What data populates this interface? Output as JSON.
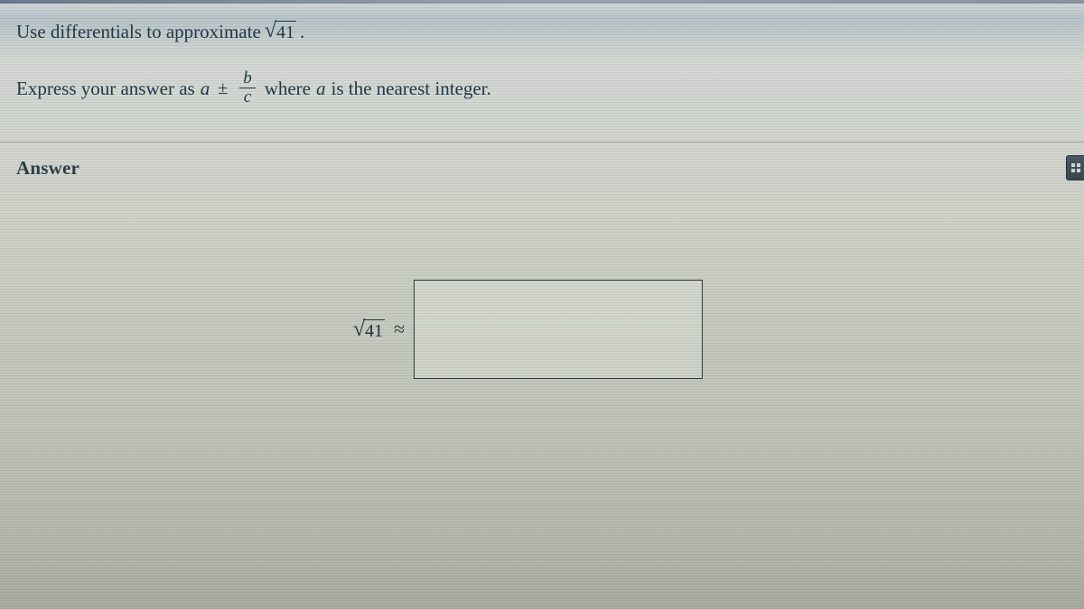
{
  "problem": {
    "instruction_prefix": "Use differentials to approximate ",
    "radicand_1": "41",
    "instruction_suffix": ".",
    "express_prefix": "Express your answer as ",
    "var_a": "a",
    "plus_minus": "±",
    "frac_num": "b",
    "frac_den": "c",
    "express_mid": " where ",
    "var_a2": "a",
    "express_suffix": " is the nearest integer."
  },
  "answer": {
    "label": "Answer",
    "radicand": "41",
    "approx_symbol": "≈",
    "input_value": ""
  },
  "icons": {
    "keypad": "keypad"
  }
}
